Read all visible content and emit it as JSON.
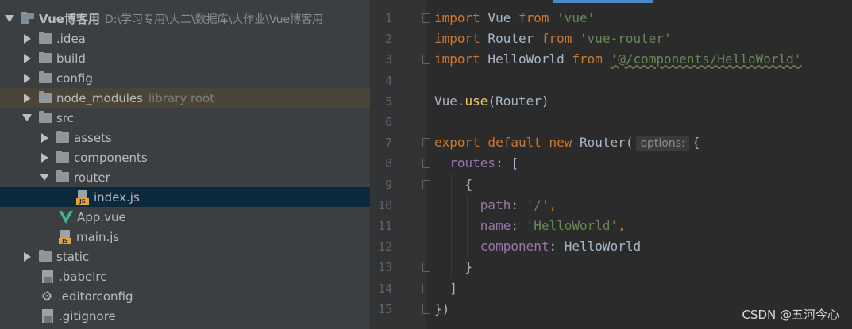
{
  "project": {
    "name": "Vue博客用",
    "path": "D:\\学习专用\\大二\\数据库\\大作业\\Vue博客用"
  },
  "tree": [
    {
      "label": "Vue博客用",
      "type": "root",
      "arrow": "open"
    },
    {
      "label": ".idea",
      "type": "folder",
      "arrow": "closed"
    },
    {
      "label": "build",
      "type": "folder",
      "arrow": "closed"
    },
    {
      "label": "config",
      "type": "folder",
      "arrow": "closed"
    },
    {
      "label": "node_modules",
      "hint": "library root",
      "type": "folder",
      "arrow": "closed"
    },
    {
      "label": "src",
      "type": "folder",
      "arrow": "open"
    },
    {
      "label": "assets",
      "type": "folder",
      "arrow": "closed"
    },
    {
      "label": "components",
      "type": "folder",
      "arrow": "closed"
    },
    {
      "label": "router",
      "type": "folder",
      "arrow": "open"
    },
    {
      "label": "index.js",
      "type": "js"
    },
    {
      "label": "App.vue",
      "type": "vue"
    },
    {
      "label": "main.js",
      "type": "js"
    },
    {
      "label": "static",
      "type": "folder",
      "arrow": "closed"
    },
    {
      "label": ".babelrc",
      "type": "config"
    },
    {
      "label": ".editorconfig",
      "type": "gear"
    },
    {
      "label": ".gitignore",
      "type": "config"
    }
  ],
  "editor": {
    "line_numbers": [
      "1",
      "2",
      "3",
      "4",
      "5",
      "6",
      "7",
      "8",
      "9",
      "10",
      "11",
      "12",
      "13",
      "14",
      "15"
    ],
    "param_hint": "options:",
    "lines": [
      [
        [
          "kw",
          "import"
        ],
        [
          "plain",
          " Vue "
        ],
        [
          "kw",
          "from"
        ],
        [
          "plain",
          " "
        ],
        [
          "str",
          "'vue'"
        ]
      ],
      [
        [
          "kw",
          "import"
        ],
        [
          "plain",
          " Router "
        ],
        [
          "kw",
          "from"
        ],
        [
          "plain",
          " "
        ],
        [
          "str",
          "'vue-router'"
        ]
      ],
      [
        [
          "kw",
          "import"
        ],
        [
          "plain",
          " HelloWorld "
        ],
        [
          "kw",
          "from"
        ],
        [
          "plain",
          " "
        ],
        [
          "strl",
          "'@/components/HelloWorld'"
        ]
      ],
      [],
      [
        [
          "plain",
          "Vue."
        ],
        [
          "fn",
          "use"
        ],
        [
          "plain",
          "(Router)"
        ]
      ],
      [],
      [
        [
          "kw",
          "export default new"
        ],
        [
          "plain",
          " Router("
        ],
        [
          "hint",
          "options:"
        ],
        [
          "plain",
          "{"
        ]
      ],
      [
        [
          "plain",
          "  "
        ],
        [
          "prop",
          "routes"
        ],
        [
          "plain",
          ": ["
        ]
      ],
      [
        [
          "plain",
          "    {"
        ]
      ],
      [
        [
          "plain",
          "      "
        ],
        [
          "prop",
          "path"
        ],
        [
          "plain",
          ": "
        ],
        [
          "str",
          "'/'"
        ],
        [
          "kw",
          ","
        ]
      ],
      [
        [
          "plain",
          "      "
        ],
        [
          "prop",
          "name"
        ],
        [
          "plain",
          ": "
        ],
        [
          "str",
          "'HelloWorld'"
        ],
        [
          "kw",
          ","
        ]
      ],
      [
        [
          "plain",
          "      "
        ],
        [
          "prop",
          "component"
        ],
        [
          "plain",
          ": HelloWorld"
        ]
      ],
      [
        [
          "plain",
          "    }"
        ]
      ],
      [
        [
          "plain",
          "  ]"
        ]
      ],
      [
        [
          "plain",
          "})"
        ]
      ]
    ]
  },
  "watermark": "CSDN @五河今心",
  "colors": {
    "tree_bg": "#3c3f41",
    "editor_bg": "#2b2b2b",
    "selected_row": "#0d293e",
    "highlight_row": "#4a4538",
    "keyword": "#cc7832",
    "string": "#6a8759",
    "function": "#ffc66d",
    "property": "#9876aa"
  }
}
